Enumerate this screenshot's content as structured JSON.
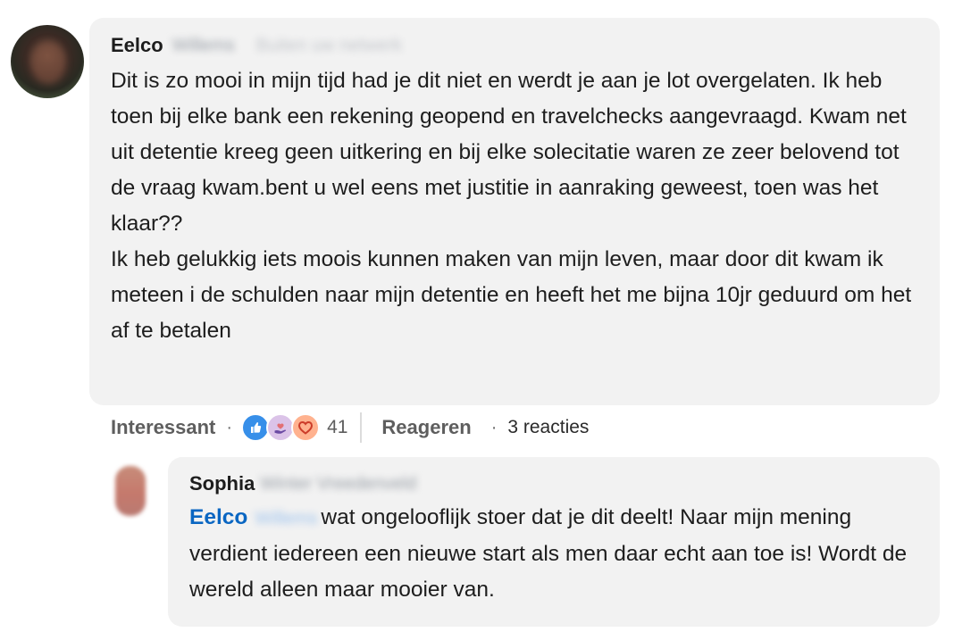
{
  "comment": {
    "author_first": "Eelco",
    "author_last_blurred": "Willems",
    "network_note_blurred": "Buiten uw netwerk",
    "paragraphs": [
      "Dit is zo mooi in mijn tijd had je dit niet en werdt je aan je lot overgelaten. Ik heb toen bij elke bank een rekening geopend en travelchecks aangevraagd. Kwam net uit detentie kreeg geen uitkering en bij elke solecitatie waren ze zeer belovend tot de vraag kwam.bent u wel eens met justitie in aanraking geweest, toen was het klaar??",
      "Ik heb gelukkig iets moois kunnen maken van mijn leven, maar door dit kwam ik meteen i de schulden naar mijn detentie en heeft het me bijna 10jr geduurd om het af te betalen"
    ]
  },
  "actions": {
    "react_label": "Interessant",
    "reactions_count": "41",
    "reply_label": "Reageren",
    "replies_count": "3 reacties"
  },
  "reaction_icons": [
    "like-icon",
    "support-icon",
    "love-icon"
  ],
  "reply": {
    "author_first": "Sophia",
    "author_last_blurred": "Winter Vreedenveld",
    "mention_first": "Eelco",
    "mention_last_blurred": "Willems",
    "text": "wat ongelooflijk stoer dat je dit deelt! Naar mijn mening verdient iedereen een nieuwe start als men daar echt aan toe is! Wordt de wereld alleen maar mooier van."
  },
  "colors": {
    "bubble_bg": "#f2f2f2",
    "mention": "#0a66c2",
    "like": "#378fe9",
    "love": "#ffb28f"
  }
}
